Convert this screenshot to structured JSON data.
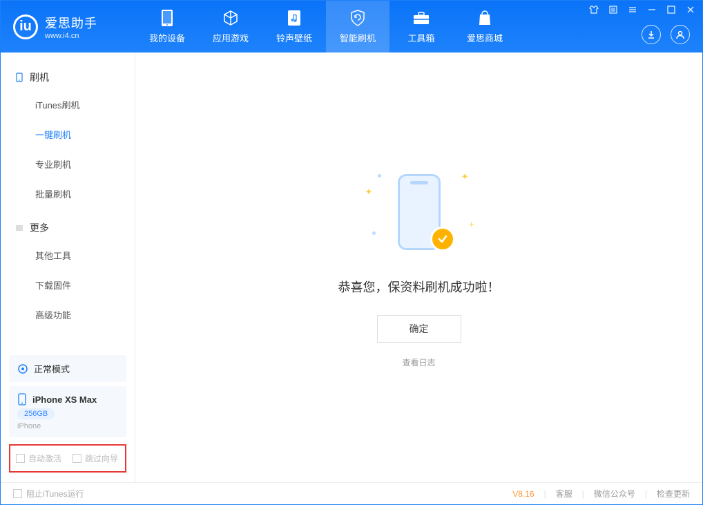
{
  "app": {
    "name": "爱思助手",
    "url": "www.i4.cn"
  },
  "nav": {
    "items": [
      {
        "label": "我的设备"
      },
      {
        "label": "应用游戏"
      },
      {
        "label": "铃声壁纸"
      },
      {
        "label": "智能刷机"
      },
      {
        "label": "工具箱"
      },
      {
        "label": "爱思商城"
      }
    ]
  },
  "sidebar": {
    "group1": {
      "title": "刷机"
    },
    "items1": [
      {
        "label": "iTunes刷机"
      },
      {
        "label": "一键刷机"
      },
      {
        "label": "专业刷机"
      },
      {
        "label": "批量刷机"
      }
    ],
    "group2": {
      "title": "更多"
    },
    "items2": [
      {
        "label": "其他工具"
      },
      {
        "label": "下载固件"
      },
      {
        "label": "高级功能"
      }
    ]
  },
  "mode": {
    "label": "正常模式"
  },
  "device": {
    "name": "iPhone XS Max",
    "capacity": "256GB",
    "type": "iPhone"
  },
  "options": {
    "auto_activate": "自动激活",
    "skip_guide": "跳过向导"
  },
  "main": {
    "success_text": "恭喜您，保资料刷机成功啦！",
    "ok": "确定",
    "view_log": "查看日志"
  },
  "footer": {
    "block_itunes": "阻止iTunes运行",
    "version": "V8.16",
    "support": "客服",
    "wechat": "微信公众号",
    "update": "检查更新"
  }
}
